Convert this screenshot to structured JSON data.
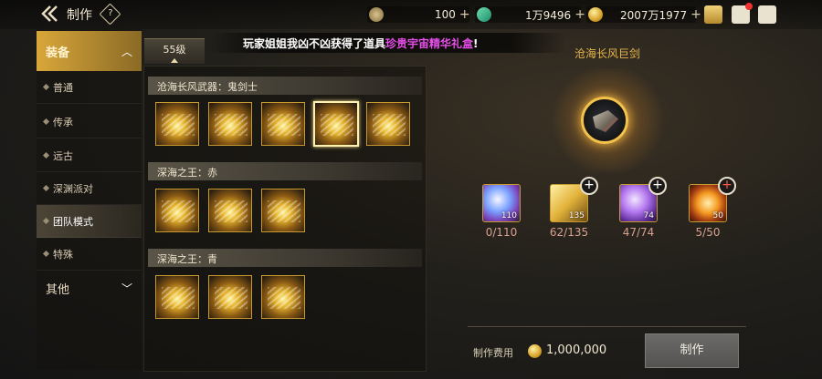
{
  "topbar": {
    "title": "制作",
    "help_label": "?",
    "currencies": [
      {
        "icon": "c-coin-icon",
        "value": "100",
        "plus": "+"
      },
      {
        "icon": "green-gem-icon",
        "value": "1万9496",
        "plus": "+"
      },
      {
        "icon": "gold-coin-icon",
        "value": "2007万1977",
        "plus": "+"
      }
    ],
    "right_icons": [
      "chest-icon",
      "mail-icon",
      "chat-icon"
    ]
  },
  "sidebar": {
    "category_equipment": "装备",
    "items": [
      {
        "label": "普通"
      },
      {
        "label": "传承"
      },
      {
        "label": "远古"
      },
      {
        "label": "深渊派对"
      },
      {
        "label": "团队模式"
      },
      {
        "label": "特殊"
      }
    ],
    "selected_index": 4,
    "category_other": "其他"
  },
  "level_tab": "55级",
  "announcement": {
    "text": "玩家姐姐我凶不凶获得了道具",
    "highlight": "珍贵宇宙精华礼盒",
    "suffix": "!"
  },
  "groups": [
    {
      "title": "沧海长风武器：鬼剑士",
      "slot_count": 5,
      "selected_slot": 3
    },
    {
      "title": "深海之王：赤",
      "slot_count": 3
    },
    {
      "title": "深海之王：青",
      "slot_count": 3
    }
  ],
  "craft": {
    "item_name": "沧海长风巨剑",
    "materials": [
      {
        "icon": "blue-orb-icon",
        "count": "110",
        "qty": "0/110",
        "has_plus": false
      },
      {
        "icon": "gold-bars-icon",
        "count": "135",
        "qty": "62/135",
        "has_plus": true
      },
      {
        "icon": "purple-crystal-icon",
        "count": "74",
        "qty": "47/74",
        "has_plus": true
      },
      {
        "icon": "fire-gem-icon",
        "count": "50",
        "qty": "5/50",
        "has_plus": true
      }
    ],
    "fee_label": "制作费用",
    "fee_value": "1,000,000",
    "button_label": "制作"
  }
}
